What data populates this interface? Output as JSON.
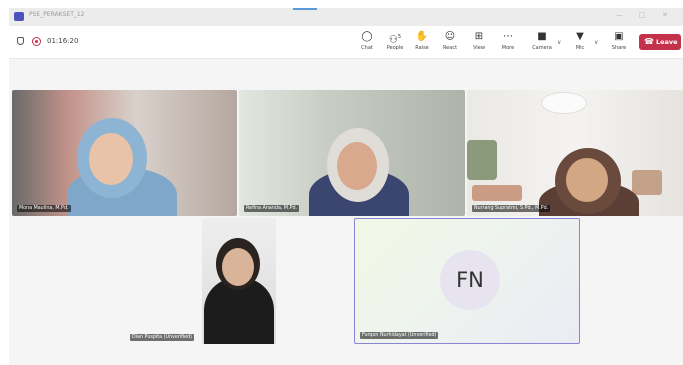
{
  "window": {
    "title": "PSE_PERAKSET_12"
  },
  "toolbar": {
    "timer": "01:16:20",
    "buttons": {
      "chat": "Chat",
      "people": "People",
      "people_count": "5",
      "raise": "Raise",
      "react": "React",
      "view": "View",
      "more": "More",
      "camera": "Camera",
      "mic": "Mic",
      "share": "Share"
    },
    "leave": "Leave",
    "accent_color": "#c4314b"
  },
  "participants": [
    {
      "name": "Mona Maulina, M.Pd."
    },
    {
      "name": "Refina Ananda, M.Pd."
    },
    {
      "name": "Nurrang Supratmi, S.Pd., M.Pd."
    },
    {
      "name": "Dian Puspita (Unverified)"
    },
    {
      "name": "Furqon Nurhidayat (Unverified)",
      "initials": "FN"
    }
  ],
  "icons": [
    "shield-icon",
    "record-icon",
    "chat-icon",
    "people-icon",
    "raise-hand-icon",
    "react-icon",
    "view-icon",
    "more-icon",
    "camera-icon",
    "mic-icon",
    "share-icon",
    "phone-icon"
  ]
}
